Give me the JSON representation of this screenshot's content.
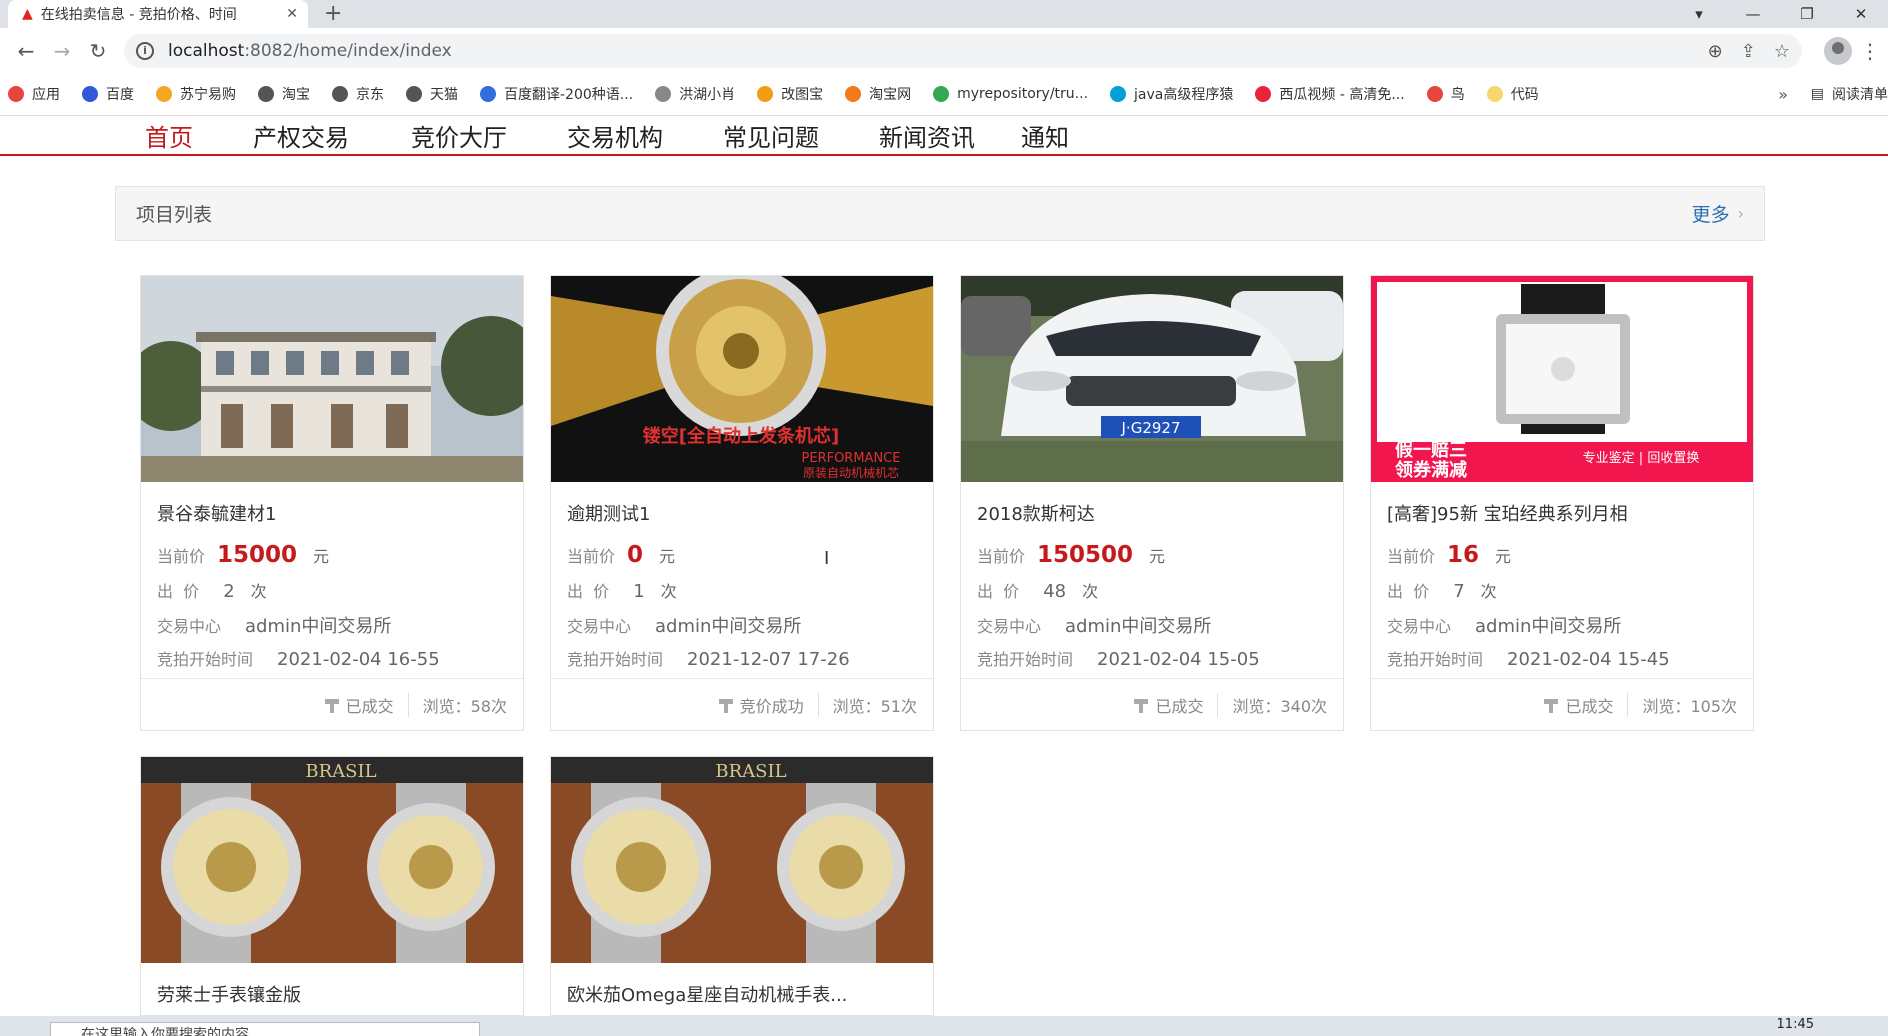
{
  "browser": {
    "tab_title": "在线拍卖信息 - 竞拍价格、时间",
    "url_host": "localhost",
    "url_path": ":8082/home/index/index",
    "bookmarks": [
      {
        "label": "应用",
        "color": "#e8453c"
      },
      {
        "label": "百度",
        "color": "#3058d8"
      },
      {
        "label": "苏宁易购",
        "color": "#f5a623"
      },
      {
        "label": "淘宝",
        "color": "#555555"
      },
      {
        "label": "京东",
        "color": "#555555"
      },
      {
        "label": "天猫",
        "color": "#555555"
      },
      {
        "label": "百度翻译-200种语...",
        "color": "#2f6de1"
      },
      {
        "label": "洪湖小肖",
        "color": "#888888"
      },
      {
        "label": "改图宝",
        "color": "#f39c12"
      },
      {
        "label": "淘宝网",
        "color": "#f07b18"
      },
      {
        "label": "myrepository/tru...",
        "color": "#34a853"
      },
      {
        "label": "java高级程序猿",
        "color": "#00a1d6"
      },
      {
        "label": "西瓜视频 - 高清免...",
        "color": "#e8233a"
      },
      {
        "label": "鸟",
        "color": "#e8453c"
      },
      {
        "label": "代码",
        "color": "#f5d76e"
      }
    ],
    "bookmarks_more": "»",
    "reading_list": "阅读清单"
  },
  "nav": {
    "items": [
      "首页",
      "产权交易",
      "竞价大厅",
      "交易机构",
      "常见问题",
      "新闻资讯",
      "通知"
    ]
  },
  "panel": {
    "title": "项目列表",
    "more": "更多"
  },
  "labels": {
    "current_price": "当前价",
    "bid_prefix": "出  价",
    "bid_unit": "次",
    "yuan": "元",
    "center": "交易中心",
    "start_time": "竞拍开始时间"
  },
  "cards": [
    {
      "name": "景谷泰毓建材1",
      "price": "15000",
      "bids": "2",
      "center": "admin中间交易所",
      "start": "2021-02-04 16-55",
      "status": "已成交",
      "views": "浏览：58次"
    },
    {
      "name": "逾期测试1",
      "price": "0",
      "bids": "1",
      "center": "admin中间交易所",
      "start": "2021-12-07 17-26",
      "status": "竞价成功",
      "views": "浏览：51次"
    },
    {
      "name": "2018款斯柯达",
      "price": "150500",
      "bids": "48",
      "center": "admin中间交易所",
      "start": "2021-02-04 15-05",
      "status": "已成交",
      "views": "浏览：340次"
    },
    {
      "name": "[高奢]95新 宝珀经典系列月相",
      "price": "16",
      "bids": "7",
      "center": "admin中间交易所",
      "start": "2021-02-04 15-45",
      "status": "已成交",
      "views": "浏览：105次"
    },
    {
      "name": "劳莱士手表镶金版"
    },
    {
      "name": "欧米茄Omega星座自动机械手表..."
    }
  ],
  "image_text": {
    "watch_banner1": "镂空[全自动上发条机芯]",
    "watch_banner2": "PERFORMANCE",
    "watch_banner3": "原装自动机械机芯",
    "plate": "J·G2927",
    "ad1": "假一赔三",
    "ad2": "领券满减",
    "ad3": "专业鉴定 | 回收置换",
    "brand_band": "BRASIL"
  },
  "taskbar": {
    "search_placeholder": "在这里输入你要搜索的内容",
    "clock": "11:45"
  }
}
